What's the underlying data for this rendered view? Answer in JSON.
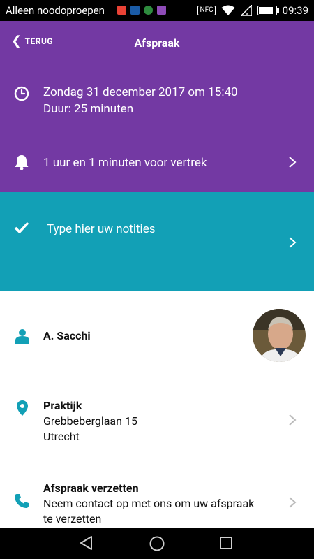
{
  "status_bar": {
    "carrier": "Alleen noodoproepen",
    "time": "09:39",
    "nfc": "NFC",
    "battery_level": 0.9,
    "app_icons": [
      "#E94235",
      "#1A5BA6",
      "#2E8B3E",
      "#8E4BB7"
    ]
  },
  "header": {
    "back_label": "TERUG",
    "title": "Afspraak"
  },
  "appointment": {
    "datetime": "Zondag 31 december 2017 om 15:40",
    "duration": "Duur: 25 minuten"
  },
  "reminder": {
    "text": "1 uur en 1 minuten voor vertrek"
  },
  "notes": {
    "placeholder": "Type hier uw notities"
  },
  "contact": {
    "name": "A. Sacchi"
  },
  "location": {
    "title": "Praktijk",
    "address_line1": "Grebbeberglaan 15",
    "address_line2": "Utrecht"
  },
  "reschedule": {
    "title": "Afspraak verzetten",
    "text_line1": "Neem contact op met ons om uw afspraak",
    "text_line2": "te verzetten"
  },
  "colors": {
    "header": "#7339A3",
    "notes": "#12A0B6",
    "accent_icon": "#12A0B6"
  },
  "icons": {
    "clock": "clock-icon",
    "bell": "bell-icon",
    "check": "check-icon",
    "person": "person-icon",
    "pin": "location-pin-icon",
    "phone": "phone-icon",
    "chevron": "chevron-right-icon"
  }
}
